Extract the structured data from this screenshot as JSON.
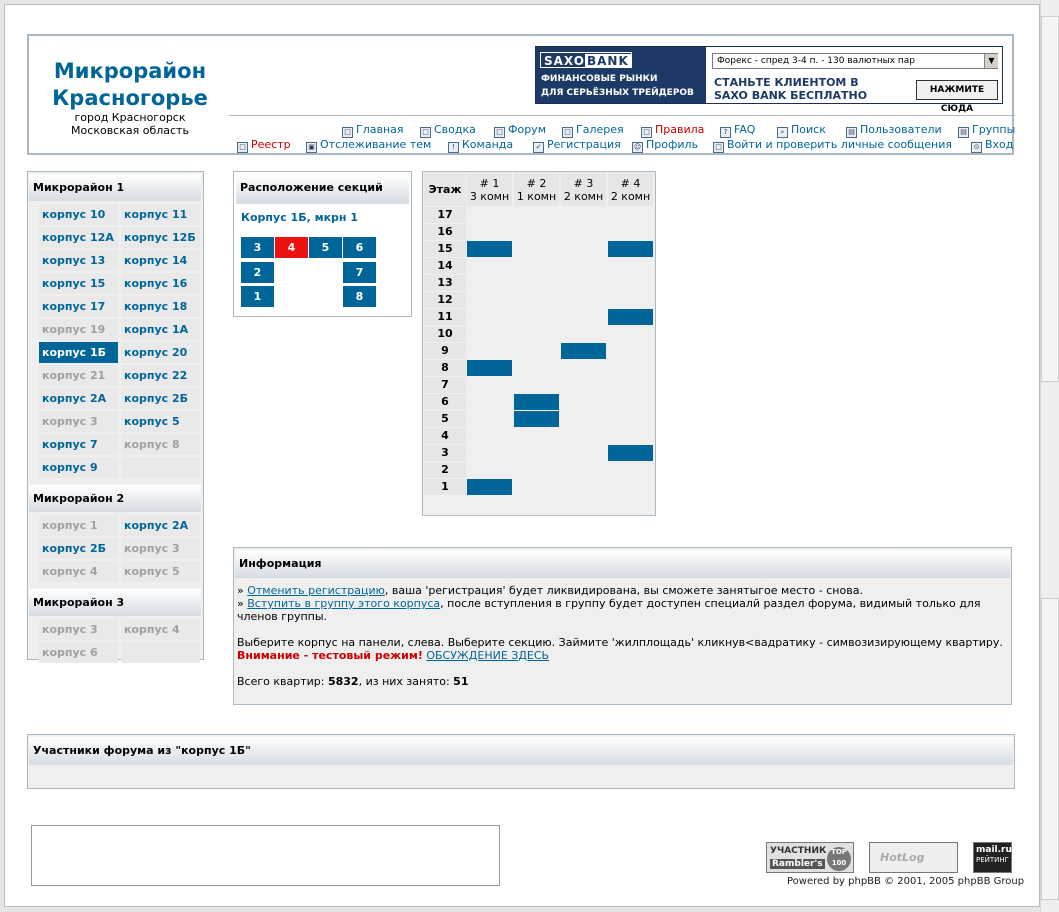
{
  "site": {
    "title_line1": "Микрорайон",
    "title_line2": "Красногорье",
    "sub_line1": "город Красногорск",
    "sub_line2": "Московская область"
  },
  "banner": {
    "logo_left": "SAXO",
    "logo_right": "BANK",
    "left_line1": "ФИНАНСОВЫЕ РЫНКИ",
    "left_line2": "ДЛЯ СЕРЬЁЗНЫХ ТРЕЙДЕРОВ",
    "select_value": "Форекс - спред 3-4 п. - 130 валютных пар",
    "right_line1": "СТАНЬТЕ КЛИЕНТОМ В",
    "right_line2": "SAXO BANK БЕСПЛАТНО",
    "button": "НАЖМИТЕ СЮДА"
  },
  "nav": {
    "row1": [
      "Главная",
      "Сводка",
      "Форум",
      "Галерея",
      "Правила",
      "FAQ",
      "Поиск",
      "Пользователи",
      "Группы"
    ],
    "row2": [
      "Реестр",
      "Отслеживание тем",
      "Команда",
      "Регистрация",
      "Профиль",
      "Войти и проверить личные сообщения",
      "Вход"
    ]
  },
  "sidebar": {
    "groups": [
      {
        "title": "Микрорайон 1",
        "items": [
          {
            "label": "корпус 10",
            "state": "link"
          },
          {
            "label": "корпус 11",
            "state": "link"
          },
          {
            "label": "корпус 12А",
            "state": "link"
          },
          {
            "label": "корпус 12Б",
            "state": "link"
          },
          {
            "label": "корпус 13",
            "state": "link"
          },
          {
            "label": "корпус 14",
            "state": "link"
          },
          {
            "label": "корпус 15",
            "state": "link"
          },
          {
            "label": "корпус 16",
            "state": "link"
          },
          {
            "label": "корпус 17",
            "state": "link"
          },
          {
            "label": "корпус 18",
            "state": "link"
          },
          {
            "label": "корпус 19",
            "state": "gray"
          },
          {
            "label": "корпус 1А",
            "state": "link"
          },
          {
            "label": "корпус 1Б",
            "state": "active"
          },
          {
            "label": "корпус 20",
            "state": "link"
          },
          {
            "label": "корпус 21",
            "state": "gray"
          },
          {
            "label": "корпус 22",
            "state": "link"
          },
          {
            "label": "корпус 2А",
            "state": "link"
          },
          {
            "label": "корпус 2Б",
            "state": "link"
          },
          {
            "label": "корпус 3",
            "state": "gray"
          },
          {
            "label": "корпус 5",
            "state": "link"
          },
          {
            "label": "корпус 7",
            "state": "link"
          },
          {
            "label": "корпус 8",
            "state": "gray"
          },
          {
            "label": "корпус 9",
            "state": "link"
          }
        ]
      },
      {
        "title": "Микрорайон 2",
        "items": [
          {
            "label": "корпус 1",
            "state": "gray"
          },
          {
            "label": "корпус 2А",
            "state": "link"
          },
          {
            "label": "корпус 2Б",
            "state": "link"
          },
          {
            "label": "корпус 3",
            "state": "gray"
          },
          {
            "label": "корпус 4",
            "state": "gray"
          },
          {
            "label": "корпус 5",
            "state": "gray"
          }
        ]
      },
      {
        "title": "Микрорайон 3",
        "items": [
          {
            "label": "корпус 3",
            "state": "gray"
          },
          {
            "label": "корпус 4",
            "state": "gray"
          },
          {
            "label": "корпус 6",
            "state": "gray"
          }
        ]
      }
    ]
  },
  "sections": {
    "title": "Расположение секций",
    "subtitle": "Корпус 1Б, мкрн 1",
    "items": [
      "3",
      "4",
      "5",
      "6",
      "2",
      "7",
      "1",
      "8"
    ],
    "selected": "4"
  },
  "floors": {
    "floor_label": "Этаж",
    "columns": [
      {
        "name": "# 1",
        "rooms": "3 комн"
      },
      {
        "name": "# 2",
        "rooms": "1 комн"
      },
      {
        "name": "# 3",
        "rooms": "2 комн"
      },
      {
        "name": "# 4",
        "rooms": "2 комн"
      }
    ],
    "rows": [
      {
        "floor": "17",
        "occupied": [
          0,
          0,
          0,
          0
        ]
      },
      {
        "floor": "16",
        "occupied": [
          0,
          0,
          0,
          0
        ]
      },
      {
        "floor": "15",
        "occupied": [
          1,
          0,
          0,
          1
        ]
      },
      {
        "floor": "14",
        "occupied": [
          0,
          0,
          0,
          0
        ]
      },
      {
        "floor": "13",
        "occupied": [
          0,
          0,
          0,
          0
        ]
      },
      {
        "floor": "12",
        "occupied": [
          0,
          0,
          0,
          0
        ]
      },
      {
        "floor": "11",
        "occupied": [
          0,
          0,
          0,
          1
        ]
      },
      {
        "floor": "10",
        "occupied": [
          0,
          0,
          0,
          0
        ]
      },
      {
        "floor": "9",
        "occupied": [
          0,
          0,
          1,
          0
        ]
      },
      {
        "floor": "8",
        "occupied": [
          1,
          0,
          0,
          0
        ]
      },
      {
        "floor": "7",
        "occupied": [
          0,
          0,
          0,
          0
        ]
      },
      {
        "floor": "6",
        "occupied": [
          0,
          1,
          0,
          0
        ]
      },
      {
        "floor": "5",
        "occupied": [
          0,
          1,
          0,
          0
        ]
      },
      {
        "floor": "4",
        "occupied": [
          0,
          0,
          0,
          0
        ]
      },
      {
        "floor": "3",
        "occupied": [
          0,
          0,
          0,
          1
        ]
      },
      {
        "floor": "2",
        "occupied": [
          0,
          0,
          0,
          0
        ]
      },
      {
        "floor": "1",
        "occupied": [
          1,
          0,
          0,
          0
        ]
      }
    ]
  },
  "info": {
    "title": "Информация",
    "line1_link": "Отменить регистрацию",
    "line1_text": ", ваша 'регистрация' будет ликвидирована, вы сможете занятыгое место - снова.",
    "line2_link": "Вступить в группу этого корпуса",
    "line2_text": ", после вступления в группу будет доступен специалй раздел форума, видимый только для членов группы.",
    "line3": "Выберите корпус на панели, слева. Выберите секцию. Займите 'жилплощадь' кликнув<вадратику - симвозизирующему квартиру.",
    "warning": "Внимание - тестовый режим!",
    "discussion_link": "ОБСУЖДЕНИЕ ЗДЕСЬ",
    "total_label": "Всего квартир:",
    "total_value": "5832",
    "taken_label": ", из них занято:",
    "taken_value": "51"
  },
  "members": {
    "title": "Участники форума из \"корпус 1Б\""
  },
  "footer": {
    "counter1_top": "УЧАСТНИК",
    "counter1_bottom": "Rambler's",
    "counter1_badge": "TOP 100",
    "counter2": "HotLog",
    "counter3_top": "mail.ru",
    "counter3_bottom": "РЕЙТИНГ",
    "powered": "Powered by phpBB © 2001, 2005 phpBB Group"
  }
}
